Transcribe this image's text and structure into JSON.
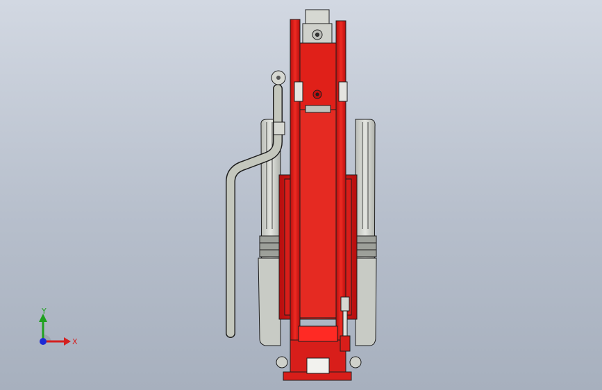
{
  "viewport": {
    "background_top": "#d2d8e2",
    "background_bottom": "#a7b0be"
  },
  "model": {
    "primary_color": "#e01818",
    "dark_red": "#a00c0c",
    "metal_color": "#c9ccc6",
    "outline_color": "#1e1e1e",
    "handle_color": "#c4c7bd"
  },
  "triad": {
    "x_label": "X",
    "y_label": "Y",
    "x_color": "#d42020",
    "y_color": "#1fa11f",
    "z_color": "#1d2ad6"
  }
}
